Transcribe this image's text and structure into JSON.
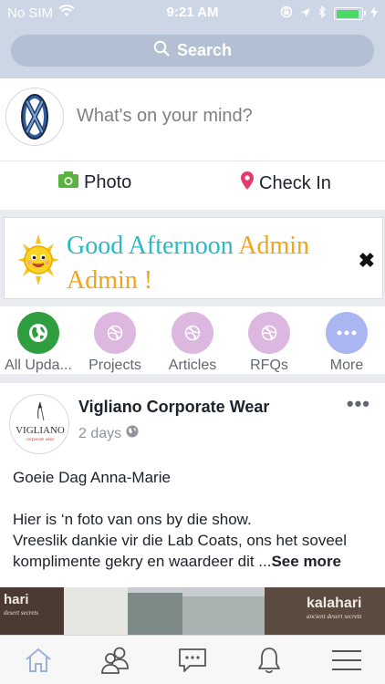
{
  "status_bar": {
    "carrier": "No SIM",
    "time": "9:21 AM",
    "battery_level": 0.9
  },
  "search": {
    "label": "Search",
    "icon": "search-icon"
  },
  "composer": {
    "placeholder": "What's on your mind?",
    "photo_label": "Photo",
    "checkin_label": "Check In"
  },
  "greeting": {
    "part1": "Good Afternoon",
    "part2": "Admin",
    "part3": "Admin !",
    "close": "✖"
  },
  "categories": [
    {
      "label": "All Upda...",
      "color": "#2f9e3f",
      "icon": "globe-icon"
    },
    {
      "label": "Projects",
      "color": "#dcb8e0",
      "icon": "dribbble-icon"
    },
    {
      "label": "Articles",
      "color": "#dcb8e0",
      "icon": "dribbble-icon"
    },
    {
      "label": "RFQs",
      "color": "#dcb8e0",
      "icon": "dribbble-icon"
    },
    {
      "label": "More",
      "color": "#aab6f2",
      "icon": "ellipsis-icon"
    }
  ],
  "post": {
    "author": "Vigliano Corporate Wear",
    "time": "2 days",
    "logo_text": "VIGLIANO",
    "logo_sub": "corporate wear",
    "more": "•••",
    "greeting": "Goeie Dag Anna-Marie",
    "body_line1": "Hier is ‘n foto van ons by die show.",
    "body_line2": "Vreeslik dankie vir die Lab Coats, ons het soveel komplimente gekry en waardeer dit ...",
    "see_more": "See more"
  },
  "photo_strip": {
    "left_sign": "hari",
    "left_sub": "desert secrets",
    "right_sign": "kalahari",
    "right_sub": "ancient desert secrets"
  },
  "colors": {
    "header": "#ccd6e4",
    "search_pill": "#b3c0d3",
    "photo_icon": "#59b33e",
    "checkin_icon": "#e8396b",
    "greeting_cyan": "#2ab8c4",
    "greeting_orange": "#f3a31a",
    "tab_active": "#9eb2d8"
  },
  "tabbar": [
    "home-icon",
    "friends-icon",
    "messages-icon",
    "notifications-icon",
    "menu-icon"
  ]
}
